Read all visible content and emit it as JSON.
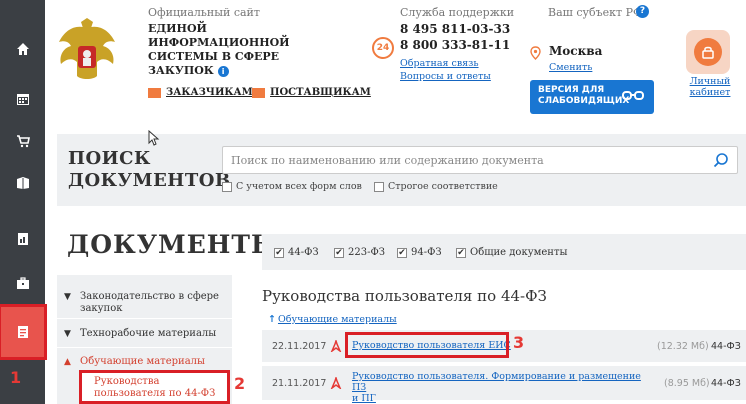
{
  "sidebar": {
    "items": [
      {
        "icon": "home-icon"
      },
      {
        "icon": "calendar-icon"
      },
      {
        "icon": "cart-icon"
      },
      {
        "icon": "book-icon"
      },
      {
        "icon": "document-chart-icon"
      },
      {
        "icon": "briefcase-icon"
      },
      {
        "icon": "documents-icon",
        "active": true
      }
    ],
    "marker": "1"
  },
  "header": {
    "site_line1": "Официальный сайт",
    "site_line2": "ЕДИНОЙ ИНФОРМАЦИОННОЙ СИСТЕМЫ В СФЕРЕ ЗАКУПОК",
    "info_icon_char": "i",
    "customers_link": "ЗАКАЗЧИКАМ",
    "suppliers_link": "ПОСТАВЩИКАМ",
    "support": {
      "title": "Служба поддержки",
      "hours": "24",
      "phone1": "8 495 811-03-33",
      "phone2": "8 800 333-81-11",
      "feedback_link": "Обратная связь",
      "faq_link": "Вопросы и ответы"
    },
    "region": {
      "title": "Ваш субъект РФ",
      "help_char": "?",
      "city": "Москва",
      "change_link": "Сменить"
    },
    "vision_button": {
      "line1": "ВЕРСИЯ ДЛЯ",
      "line2": "СЛАБОВИДЯЩИХ"
    },
    "cabinet": {
      "line1": "Личный",
      "line2": "кабинет"
    }
  },
  "search": {
    "title_line1": "ПОИСК",
    "title_line2": "ДОКУМЕНТОВ",
    "placeholder": "Поиск по наименованию или содержанию документа",
    "option_all_forms": "С учетом всех форм слов",
    "option_exact": "Строгое соответствие"
  },
  "documents": {
    "title": "ДОКУМЕНТЫ",
    "filters": [
      {
        "label": "44-ФЗ",
        "checked": true
      },
      {
        "label": "223-ФЗ",
        "checked": true
      },
      {
        "label": "94-ФЗ",
        "checked": true
      },
      {
        "label": "Общие документы",
        "checked": true
      }
    ],
    "check_char": "✔",
    "menu": [
      {
        "label": "Законодательство в сфере закупок",
        "chevron": "▼"
      },
      {
        "label": "Технорабочие материалы",
        "chevron": "▼"
      },
      {
        "label": "Обучающие материалы",
        "chevron": "▲"
      }
    ],
    "submenu_active": "Руководства пользователя по 44-ФЗ",
    "marker_submenu": "2",
    "section_title": "Руководства пользователя по 44-ФЗ",
    "back_link": "Обучающие материалы",
    "rows": [
      {
        "date": "22.11.2017",
        "title": "Руководство пользователя ЕИС",
        "size": "(12.32 Мб)",
        "law": "44-ФЗ"
      },
      {
        "date": "21.11.2017",
        "title_line1": "Руководство пользователя. Формирование и размещение ПЗ",
        "title_line2": "и ПГ",
        "size": "(8.95 Мб)",
        "law": "44-ФЗ"
      }
    ],
    "marker_row": "3"
  }
}
